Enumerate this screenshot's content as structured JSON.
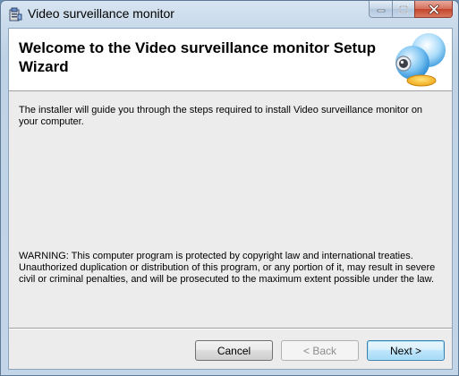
{
  "window": {
    "title": "Video surveillance monitor",
    "app_icon": "installer-icon"
  },
  "caption_buttons": {
    "minimize_icon": "minimize-icon",
    "maximize_icon": "maximize-icon",
    "close_icon": "close-icon"
  },
  "banner": {
    "title": "Welcome to the Video surveillance monitor Setup Wizard",
    "graphic": "webcam-icon"
  },
  "body": {
    "intro": "The installer will guide you through the steps required to install Video surveillance monitor on your computer.",
    "warning": "WARNING: This computer program is protected by copyright law and international treaties. Unauthorized duplication or distribution of this program, or any portion of it, may result in severe civil or criminal penalties, and will be prosecuted to the maximum extent possible under the law."
  },
  "buttons": {
    "cancel": "Cancel",
    "back": "< Back",
    "next": "Next >"
  },
  "colors": {
    "frame": "#c3d5e8",
    "client_bg": "#ececec",
    "banner_bg": "#ffffff",
    "default_button_border": "#3c7fb1"
  }
}
